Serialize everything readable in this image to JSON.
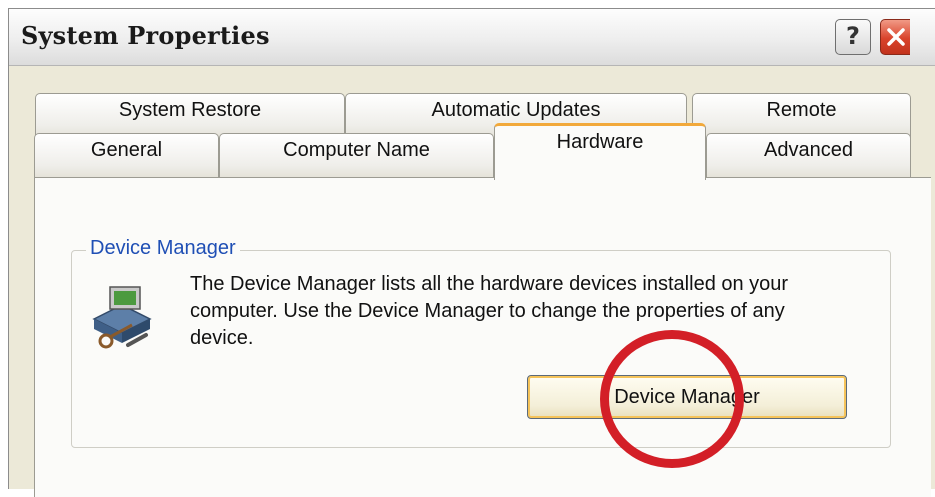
{
  "window": {
    "title": "System Properties",
    "help_glyph": "?",
    "close_icon": "close-icon"
  },
  "tabs_back": [
    {
      "label": "System Restore"
    },
    {
      "label": "Automatic Updates"
    },
    {
      "label": "Remote"
    }
  ],
  "tabs_front": [
    {
      "label": "General"
    },
    {
      "label": "Computer Name"
    },
    {
      "label": "Hardware",
      "active": true
    },
    {
      "label": "Advanced"
    }
  ],
  "device_manager": {
    "group_title": "Device Manager",
    "icon": "device-manager-icon",
    "description": "The Device Manager lists all the hardware devices installed on your computer. Use the Device Manager to change the properties of any device.",
    "button_label": "Device Manager"
  },
  "colors": {
    "active_tab_accent": "#f2a93b",
    "group_title": "#1f4fb5",
    "annotation": "#d31f27",
    "close_button": "#d9432b"
  }
}
